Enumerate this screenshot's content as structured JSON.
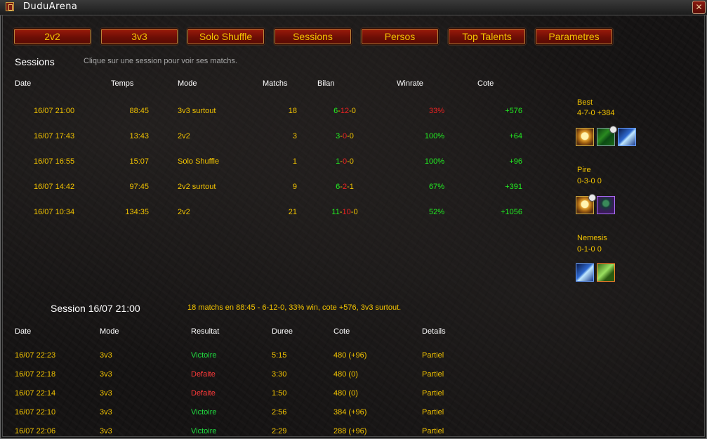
{
  "window": {
    "title": "DuduArena",
    "close_label": "✕"
  },
  "colors": {
    "gold": "#f3c400",
    "win": "#22ee22",
    "loss": "#ee2222",
    "tab_red": "#8a1408"
  },
  "tabs": [
    "2v2",
    "3v3",
    "Solo Shuffle",
    "Sessions",
    "Persos",
    "Top Talents",
    "Parametres"
  ],
  "sessions": {
    "title": "Sessions",
    "hint": "Clique sur une session pour voir ses matchs.",
    "headers": {
      "date": "Date",
      "time": "Temps",
      "mode": "Mode",
      "matches": "Matchs",
      "record": "Bilan",
      "winrate": "Winrate",
      "rating": "Cote"
    },
    "rows": [
      {
        "date": "16/07 21:00",
        "time": "88:45",
        "mode": "3v3 surtout",
        "matches": "18",
        "w": "6",
        "l": "12",
        "d": "0",
        "winrate": "33%",
        "rating": "+576"
      },
      {
        "date": "16/07 17:43",
        "time": "13:43",
        "mode": "2v2",
        "matches": "3",
        "w": "3",
        "l": "0",
        "d": "0",
        "winrate": "100%",
        "rating": "+64"
      },
      {
        "date": "16/07 16:55",
        "time": "15:07",
        "mode": "Solo Shuffle",
        "matches": "1",
        "w": "1",
        "l": "0",
        "d": "0",
        "winrate": "100%",
        "rating": "+96"
      },
      {
        "date": "16/07 14:42",
        "time": "97:45",
        "mode": "2v2 surtout",
        "matches": "9",
        "w": "6",
        "l": "2",
        "d": "1",
        "winrate": "67%",
        "rating": "+391"
      },
      {
        "date": "16/07 10:34",
        "time": "134:35",
        "mode": "2v2",
        "matches": "21",
        "w": "11",
        "l": "10",
        "d": "0",
        "winrate": "52%",
        "rating": "+1056"
      }
    ],
    "sep": "-"
  },
  "sidebar": {
    "best": {
      "label": "Best",
      "record": "4-7-0",
      "rating": "+384",
      "icons": [
        "healer-portrait-icon",
        "nature-spell-icon",
        "frost-bolt-icon"
      ]
    },
    "worst": {
      "label": "Pire",
      "record": "0-3-0",
      "rating": "0",
      "icons": [
        "healer-portrait-icon",
        "demon-portrait-icon"
      ]
    },
    "nemesis": {
      "label": "Nemesis",
      "record": "0-1-0",
      "rating": "0",
      "icons": [
        "frost-bolt-icon",
        "leaf-spell-icon"
      ]
    }
  },
  "detail": {
    "title": "Session 16/07 21:00",
    "summary": "18 matchs en 88:45 - 6-12-0, 33% win, cote +576, 3v3 surtout.",
    "headers": {
      "date": "Date",
      "mode": "Mode",
      "result": "Resultat",
      "duration": "Duree",
      "rating": "Cote",
      "details": "Details"
    },
    "rows": [
      {
        "date": "16/07 22:23",
        "mode": "3v3",
        "result": "Victoire",
        "win": true,
        "duration": "5:15",
        "rating": "480 (+96)",
        "details": "Partiel"
      },
      {
        "date": "16/07 22:18",
        "mode": "3v3",
        "result": "Defaite",
        "win": false,
        "duration": "3:30",
        "rating": "480 (0)",
        "details": "Partiel"
      },
      {
        "date": "16/07 22:14",
        "mode": "3v3",
        "result": "Defaite",
        "win": false,
        "duration": "1:50",
        "rating": "480 (0)",
        "details": "Partiel"
      },
      {
        "date": "16/07 22:10",
        "mode": "3v3",
        "result": "Victoire",
        "win": true,
        "duration": "2:56",
        "rating": "384 (+96)",
        "details": "Partiel"
      },
      {
        "date": "16/07 22:06",
        "mode": "3v3",
        "result": "Victoire",
        "win": true,
        "duration": "2:29",
        "rating": "288 (+96)",
        "details": "Partiel"
      }
    ]
  }
}
